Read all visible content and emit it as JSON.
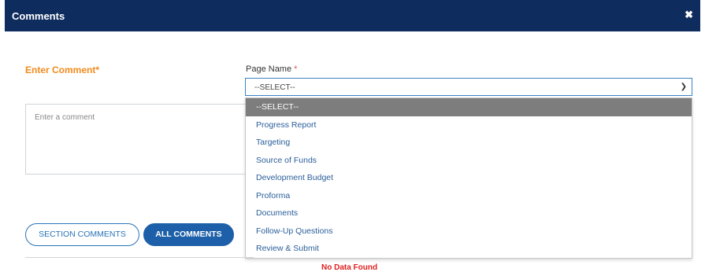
{
  "header": {
    "title": "Comments",
    "close_icon": "close-icon",
    "background": "#0e2d5e"
  },
  "form": {
    "enter_comment_label": "Enter Comment*",
    "comment_placeholder": "Enter a comment",
    "page_name_label": "Page Name",
    "required_mark": "*",
    "select_value": "--SELECT--",
    "dropdown_options": [
      "--SELECT--",
      "Progress Report",
      "Targeting",
      "Source of Funds",
      "Development Budget",
      "Proforma",
      "Documents",
      "Follow-Up Questions",
      "Review & Submit"
    ]
  },
  "buttons": {
    "section_comments": "SECTION COMMENTS",
    "all_comments": "ALL COMMENTS"
  },
  "status": {
    "no_data": "No Data Found"
  },
  "colors": {
    "accent_orange": "#f28a1c",
    "primary_blue": "#1d5fa8",
    "error_red": "#e02020"
  }
}
